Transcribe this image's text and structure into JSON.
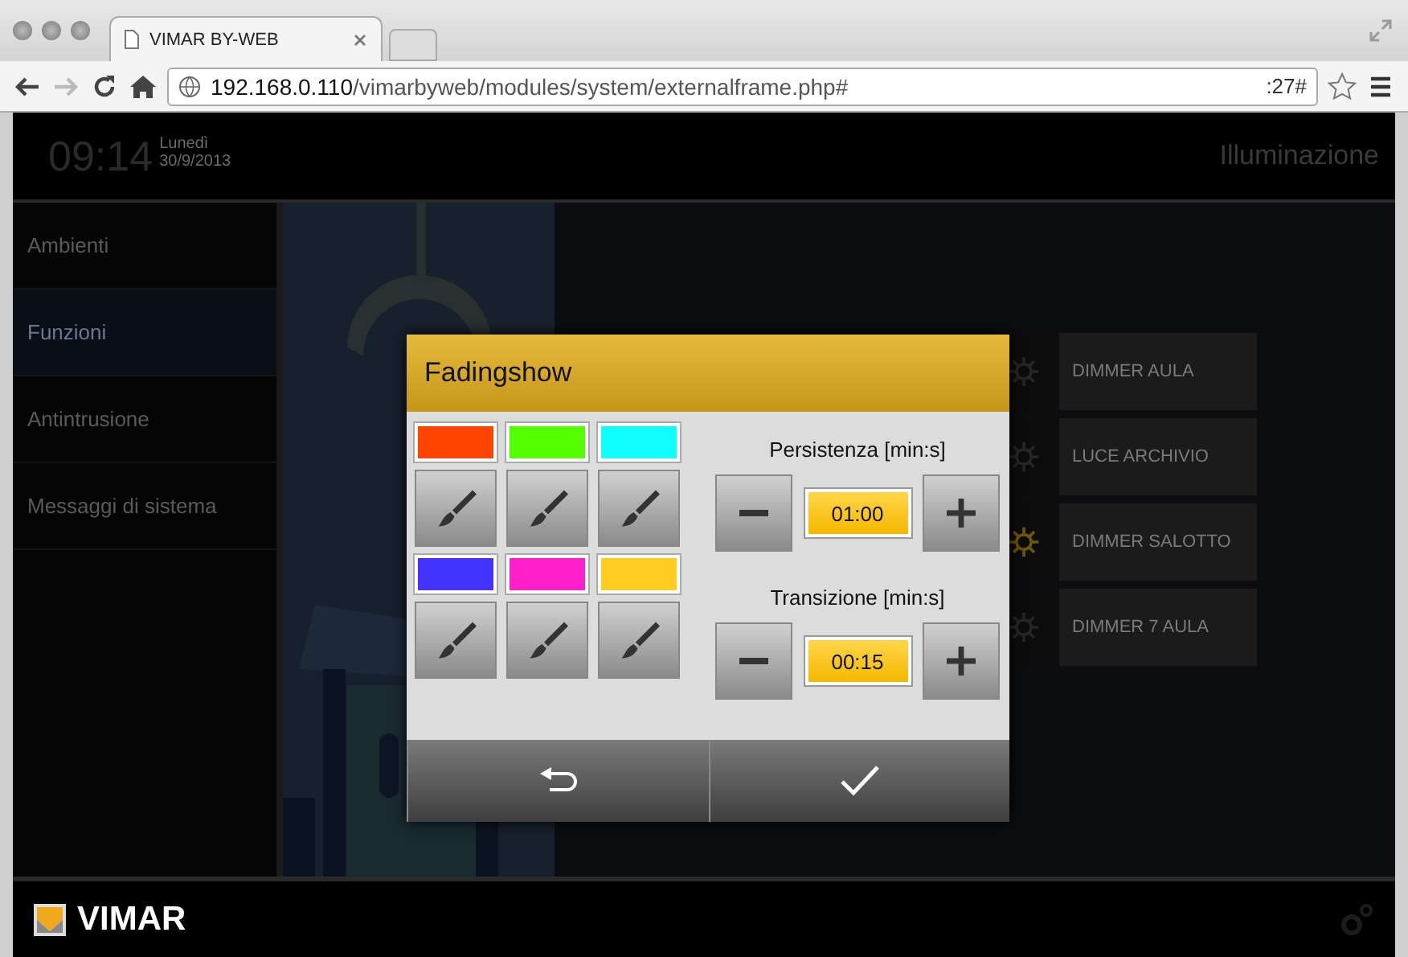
{
  "browser": {
    "tab_title": "VIMAR BY-WEB",
    "url_host": "192.168.0.110",
    "url_path": "/vimarbyweb/modules/system/externalframe.php#",
    "url_suffix": ":27#"
  },
  "header": {
    "time": "09:14",
    "day": "Lunedì",
    "date": "30/9/2013",
    "title": "Illuminazione"
  },
  "sidebar": {
    "items": [
      {
        "label": "Ambienti",
        "selected": false
      },
      {
        "label": "Funzioni",
        "selected": true
      },
      {
        "label": "Antintrusione",
        "selected": false
      },
      {
        "label": "Messaggi di sistema",
        "selected": false
      }
    ]
  },
  "devices": [
    {
      "name": "DIMMER AULA",
      "on": false
    },
    {
      "name": "LUCE ARCHIVIO",
      "on": false
    },
    {
      "name": "DIMMER SALOTTO",
      "on": true
    },
    {
      "name": "DIMMER 7 AULA",
      "on": false
    }
  ],
  "dialog": {
    "title": "Fadingshow",
    "swatches": [
      {
        "color": "#ff4400"
      },
      {
        "color": "#55ff00"
      },
      {
        "color": "#11ffff"
      },
      {
        "color": "#4433ff"
      },
      {
        "color": "#ff22cc"
      },
      {
        "color": "#ffcc22"
      }
    ],
    "steppers": [
      {
        "label": "Persistenza [min:s]",
        "value": "01:00"
      },
      {
        "label": "Transizione [min:s]",
        "value": "00:15"
      }
    ]
  },
  "footer": {
    "brand": "VIMAR"
  }
}
